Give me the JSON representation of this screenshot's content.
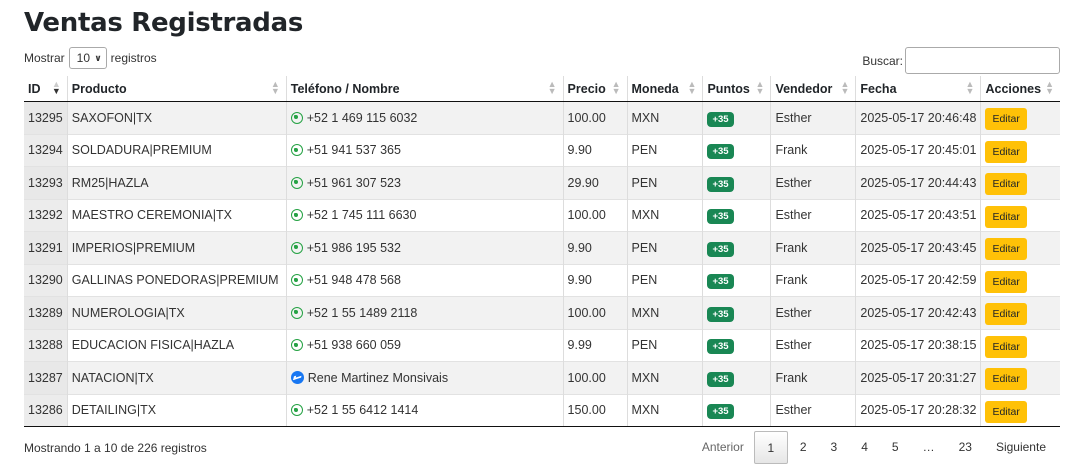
{
  "page": {
    "title": "Ventas Registradas"
  },
  "controls": {
    "length_prefix": "Mostrar",
    "length_value": "10",
    "length_suffix": "registros",
    "search_label": "Buscar:",
    "search_value": ""
  },
  "table": {
    "headers": [
      "ID",
      "Producto",
      "Teléfono / Nombre",
      "Precio",
      "Moneda",
      "Puntos",
      "Vendedor",
      "Fecha",
      "Acciones"
    ],
    "rows": [
      {
        "id": "13295",
        "producto": "SAXOFON|TX",
        "contacto": "+52 1 469 115 6032",
        "contact_icon": "whatsapp-icon",
        "precio": "100.00",
        "moneda": "MXN",
        "puntos": "+35",
        "vendedor": "Esther",
        "fecha": "2025-05-17 20:46:48",
        "accion": "Editar"
      },
      {
        "id": "13294",
        "producto": "SOLDADURA|PREMIUM",
        "contacto": "+51 941 537 365",
        "contact_icon": "whatsapp-icon",
        "precio": "9.90",
        "moneda": "PEN",
        "puntos": "+35",
        "vendedor": "Frank",
        "fecha": "2025-05-17 20:45:01",
        "accion": "Editar"
      },
      {
        "id": "13293",
        "producto": "RM25|HAZLA",
        "contacto": "+51 961 307 523",
        "contact_icon": "whatsapp-icon",
        "precio": "29.90",
        "moneda": "PEN",
        "puntos": "+35",
        "vendedor": "Esther",
        "fecha": "2025-05-17 20:44:43",
        "accion": "Editar"
      },
      {
        "id": "13292",
        "producto": "MAESTRO CEREMONIA|TX",
        "contacto": "+52 1 745 111 6630",
        "contact_icon": "whatsapp-icon",
        "precio": "100.00",
        "moneda": "MXN",
        "puntos": "+35",
        "vendedor": "Esther",
        "fecha": "2025-05-17 20:43:51",
        "accion": "Editar"
      },
      {
        "id": "13291",
        "producto": "IMPERIOS|PREMIUM",
        "contacto": "+51 986 195 532",
        "contact_icon": "whatsapp-icon",
        "precio": "9.90",
        "moneda": "PEN",
        "puntos": "+35",
        "vendedor": "Frank",
        "fecha": "2025-05-17 20:43:45",
        "accion": "Editar"
      },
      {
        "id": "13290",
        "producto": "GALLINAS PONEDORAS|PREMIUM",
        "contacto": "+51 948 478 568",
        "contact_icon": "whatsapp-icon",
        "precio": "9.90",
        "moneda": "PEN",
        "puntos": "+35",
        "vendedor": "Frank",
        "fecha": "2025-05-17 20:42:59",
        "accion": "Editar"
      },
      {
        "id": "13289",
        "producto": "NUMEROLOGIA|TX",
        "contacto": "+52 1 55 1489 2118",
        "contact_icon": "whatsapp-icon",
        "precio": "100.00",
        "moneda": "MXN",
        "puntos": "+35",
        "vendedor": "Esther",
        "fecha": "2025-05-17 20:42:43",
        "accion": "Editar"
      },
      {
        "id": "13288",
        "producto": "EDUCACION FISICA|HAZLA",
        "contacto": "+51 938 660 059",
        "contact_icon": "whatsapp-icon",
        "precio": "9.99",
        "moneda": "PEN",
        "puntos": "+35",
        "vendedor": "Esther",
        "fecha": "2025-05-17 20:38:15",
        "accion": "Editar"
      },
      {
        "id": "13287",
        "producto": "NATACION|TX",
        "contacto": "Rene Martinez Monsivais",
        "contact_icon": "messenger-icon",
        "precio": "100.00",
        "moneda": "MXN",
        "puntos": "+35",
        "vendedor": "Frank",
        "fecha": "2025-05-17 20:31:27",
        "accion": "Editar"
      },
      {
        "id": "13286",
        "producto": "DETAILING|TX",
        "contacto": "+52 1 55 6412 1414",
        "contact_icon": "whatsapp-icon",
        "precio": "150.00",
        "moneda": "MXN",
        "puntos": "+35",
        "vendedor": "Esther",
        "fecha": "2025-05-17 20:28:32",
        "accion": "Editar"
      }
    ]
  },
  "footer": {
    "info": "Mostrando 1 a 10 de 226 registros",
    "prev": "Anterior",
    "pages": [
      "1",
      "2",
      "3",
      "4",
      "5",
      "…",
      "23"
    ],
    "current_page": "1",
    "next": "Siguiente"
  },
  "colors": {
    "badge": "#198754",
    "edit_button": "#ffc107",
    "whatsapp": "#25a244",
    "messenger": "#1877f2"
  }
}
